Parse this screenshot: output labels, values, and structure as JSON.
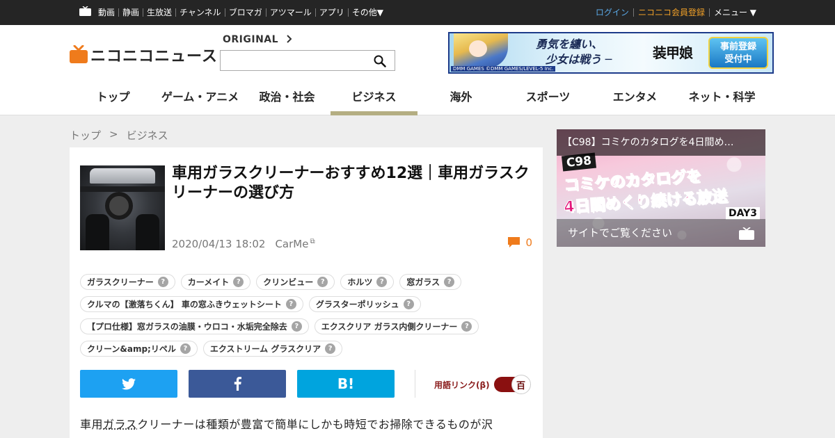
{
  "topbar": {
    "nav": [
      "動画",
      "静画",
      "生放送",
      "チャンネル",
      "ブロマガ",
      "アツマール",
      "アプリ",
      "その他▼"
    ],
    "login": "ログイン",
    "register": "ニコニコ会員登録",
    "menu": "メニュー ▼"
  },
  "header": {
    "site_name": "ニコニコニュース",
    "original_label": "ORIGINAL",
    "search_placeholder": "",
    "ad": {
      "tag": "DMM GAMES ©DMM GAMES/LEVEL-5 Inc.",
      "copy_line1": "勇気を纏い、",
      "copy_line2": "少女は戦う ─",
      "title": "装甲娘",
      "cta_line1": "事前登録",
      "cta_line2": "受付中"
    },
    "categories": [
      {
        "label": "トップ",
        "active": false
      },
      {
        "label": "ゲーム・アニメ",
        "active": false
      },
      {
        "label": "政治・社会",
        "active": false
      },
      {
        "label": "ビジネス",
        "active": true
      },
      {
        "label": "海外",
        "active": false
      },
      {
        "label": "スポーツ",
        "active": false
      },
      {
        "label": "エンタメ",
        "active": false
      },
      {
        "label": "ネット・科学",
        "active": false
      }
    ]
  },
  "breadcrumb": {
    "home": "トップ",
    "separator": ">",
    "current": "ビジネス"
  },
  "article": {
    "title": "車用ガラスクリーナーおすすめ12選｜車用ガラスクリーナーの選び方",
    "date": "2020/04/13 18:02",
    "source": "CarMe",
    "comment_count": "0",
    "tags": [
      "ガラスクリーナー",
      "カーメイト",
      "クリンビュー",
      "ホルツ",
      "窓ガラス",
      "クルマの【激落ちくん】 車の窓ふきウェットシート",
      "グラスターポリッシュ",
      "【プロ仕様】窓ガラスの油膜・ウロコ・水垢完全除去",
      "エクスクリア ガラス内側クリーナー",
      "クリーン&amp;リペル",
      "エクストリーム グラスクリア"
    ],
    "tag_help_glyph": "?",
    "glossary_label": "用語リンク(β)",
    "glossary_toggle": "百",
    "hatena_label": "B!",
    "body_prefix": "車用",
    "body_term": "ガラス",
    "body_rest": "クリーナーは種類が豊富で簡単にしかも時短でお掃除できるものが沢"
  },
  "promo": {
    "headline": "【C98】コミケのカタログを4日間め…",
    "badge": "C98",
    "line1": "コミケのカタログを",
    "line2": "4日間めくり続ける放送",
    "day": "DAY3",
    "footer": "サイトでご覧ください"
  },
  "colors": {
    "topbar_bg": "#252525",
    "logo_orange": "#ef7b1c",
    "active_underline": "#b4ae82",
    "twitter": "#1da1f2",
    "facebook": "#3b5998",
    "hatena": "#00a4de",
    "glossary_red": "#8a1010"
  }
}
